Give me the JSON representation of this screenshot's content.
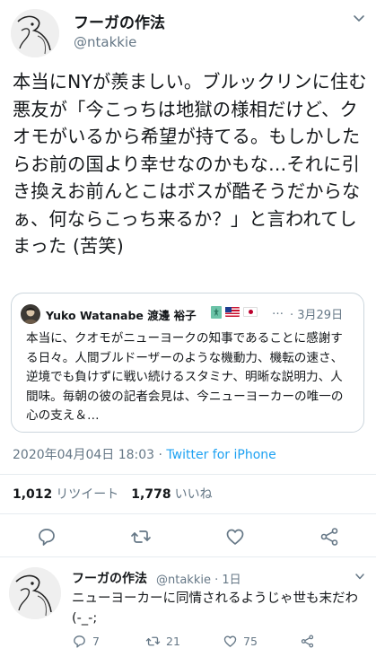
{
  "tweet": {
    "author": {
      "display_name": "フーガの作法",
      "handle": "@ntakkie"
    },
    "text": "本当にNYが羨ましい。ブルックリンに住む悪友が「今こっちは地獄の様相だけど、クオモがいるから希望が持てる。もしかしたらお前の国より幸せなのかもな…それに引き換えお前んとこはボスが酷そうだからなぁ、何ならこっち来るか？」と言われてしまった (苦笑)",
    "quoted": {
      "author_name": "Yuko Watanabe 渡邊 裕子",
      "ellipsis": "…",
      "date": "· 3月29日",
      "text": "本当に、クオモがニューヨークの知事であることに感謝する日々。人間ブルドーザーのような機動力、機転の速さ、逆境でも負けずに戦い続けるスタミナ、明晰な説明力、人間味。毎朝の彼の記者会見は、今ニューヨーカーの唯一の心の支え＆…"
    },
    "timestamp": "2020年04月04日 18:03",
    "via": "Twitter for iPhone",
    "stats": {
      "retweets_count": "1,012",
      "retweets_label": "リツイート",
      "likes_count": "1,778",
      "likes_label": "いいね"
    }
  },
  "reply": {
    "display_name": "フーガの作法",
    "handle_time": "@ntakkie · 1日",
    "text": "ニューヨーカーに同情されるようじゃ世も末だわ (-_-;",
    "counts": {
      "replies": "7",
      "retweets": "21",
      "likes": "75"
    }
  },
  "icons": {
    "reply": "speech-bubble-icon",
    "retweet": "retweet-icon",
    "like": "heart-icon",
    "share": "share-icon",
    "menu": "chevron-down-icon"
  },
  "colors": {
    "text": "#14171a",
    "secondary": "#657786",
    "link": "#1da1f2",
    "border": "#ccd6dd",
    "divider": "#e6ecf0"
  }
}
